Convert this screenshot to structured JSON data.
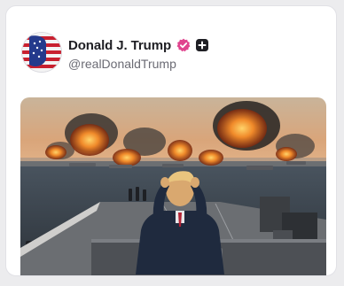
{
  "post": {
    "author": {
      "display_name": "Donald J. Trump",
      "handle": "@realDonaldTrump",
      "verified_badge_color": "#e0448e"
    },
    "media": {
      "type": "image"
    }
  },
  "icons": {
    "verified": "verified-badge-icon",
    "follow": "plus-square-icon"
  },
  "colors": {
    "card_background": "#ffffff",
    "page_background": "#ececee",
    "name_text": "#1f1f24",
    "handle_text": "#6b6b74"
  }
}
